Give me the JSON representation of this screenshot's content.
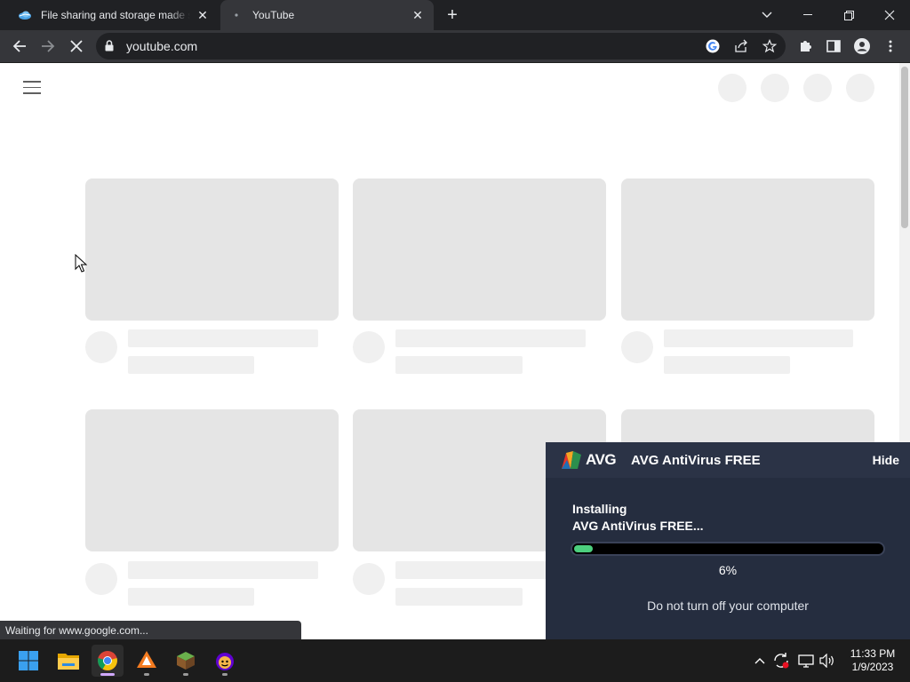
{
  "tabs": [
    {
      "title": "File sharing and storage made simple",
      "favicon": "cloud-icon",
      "active": false
    },
    {
      "title": "YouTube",
      "favicon": "loading-spinner-icon",
      "active": true
    }
  ],
  "omnibox": {
    "url": "youtube.com"
  },
  "status_bubble": "Waiting for www.google.com...",
  "avg": {
    "logo_text": "AVG",
    "title": "AVG AntiVirus FREE",
    "hide_label": "Hide",
    "installing_line1": "Installing",
    "installing_line2": "AVG AntiVirus FREE...",
    "progress": 0.06,
    "percent_label": "6%",
    "note": "Do not turn off your computer",
    "accent_color": "#4ccf7e"
  },
  "taskbar": {
    "apps": [
      "start-icon",
      "file-explorer-icon",
      "chrome-icon",
      "avast-icon",
      "minecraft-icon",
      "yahoo-icon"
    ],
    "time": "11:33 PM",
    "date": "1/9/2023"
  }
}
